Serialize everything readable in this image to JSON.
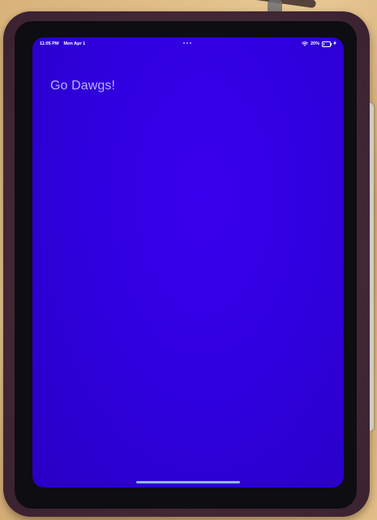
{
  "status_bar": {
    "time": "11:05 PM",
    "date": "Mon Apr 1",
    "battery_text": "20%",
    "battery_level": 0.2
  },
  "icons": {
    "wifi": "wifi-icon",
    "battery": "battery-icon",
    "charging": "charging-bolt-icon",
    "multitask": "multitasking-dots-icon"
  },
  "app": {
    "greeting": "Go Dawgs!"
  },
  "colors": {
    "screen_background": "#3000e0",
    "greeting_text": "#b9b1ff",
    "home_indicator": "#8fb4ff"
  }
}
